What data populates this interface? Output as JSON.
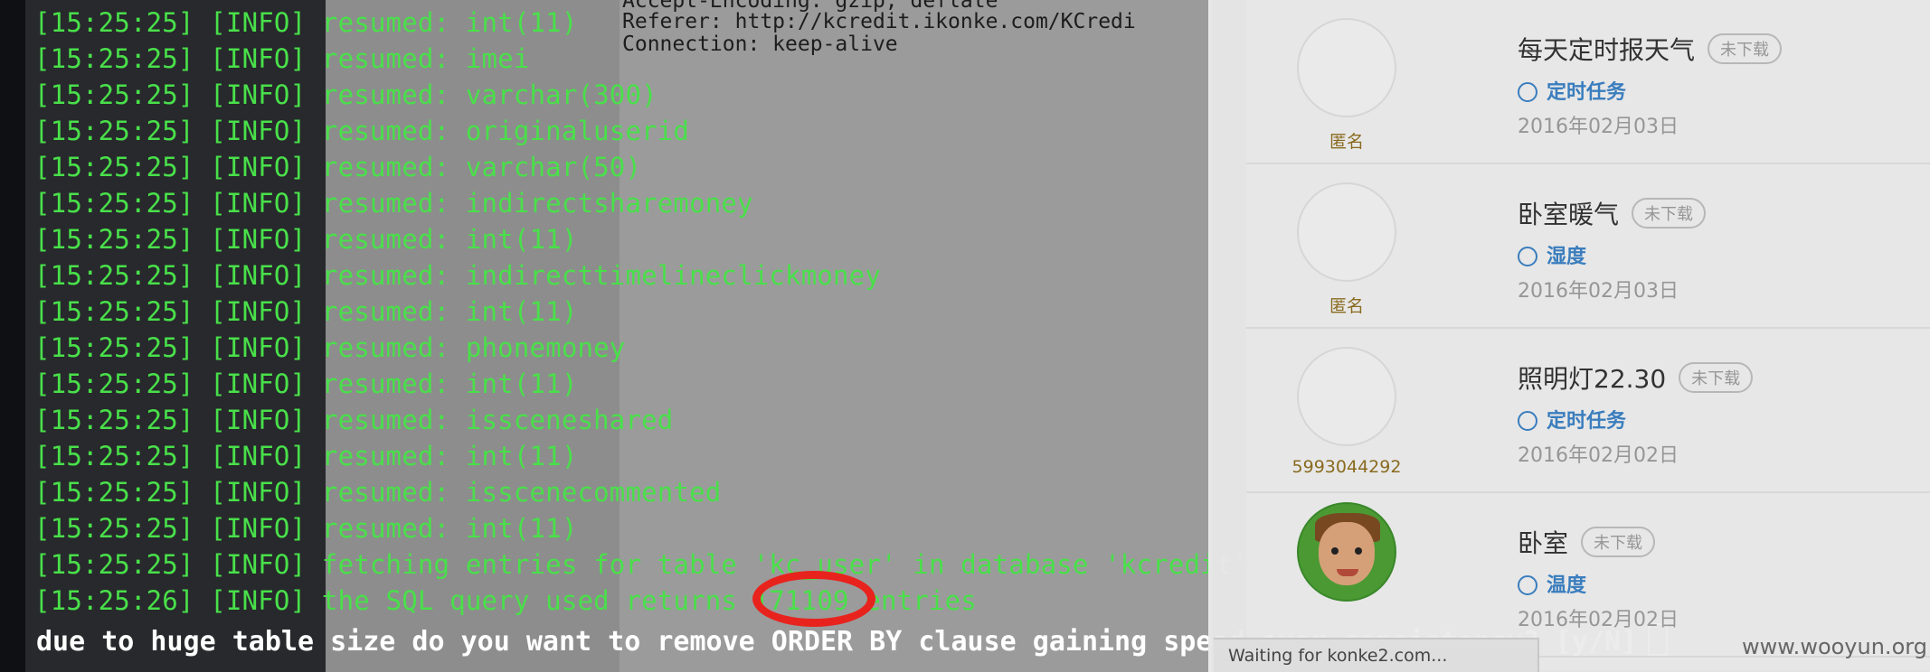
{
  "http_headers": [
    "Accept-Encoding: gzip, deflate",
    "Referer: http://kcredit.ikonke.com/KCredi",
    "Connection: keep-alive"
  ],
  "log_lines": [
    {
      "ts": "[15:25:25]",
      "level": "[INFO]",
      "msg": "resumed: int(11)"
    },
    {
      "ts": "[15:25:25]",
      "level": "[INFO]",
      "msg": "resumed: imei"
    },
    {
      "ts": "[15:25:25]",
      "level": "[INFO]",
      "msg": "resumed: varchar(300)"
    },
    {
      "ts": "[15:25:25]",
      "level": "[INFO]",
      "msg": "resumed: originaluserid"
    },
    {
      "ts": "[15:25:25]",
      "level": "[INFO]",
      "msg": "resumed: varchar(50)"
    },
    {
      "ts": "[15:25:25]",
      "level": "[INFO]",
      "msg": "resumed: indirectsharemoney"
    },
    {
      "ts": "[15:25:25]",
      "level": "[INFO]",
      "msg": "resumed: int(11)"
    },
    {
      "ts": "[15:25:25]",
      "level": "[INFO]",
      "msg": "resumed: indirecttimelineclickmoney"
    },
    {
      "ts": "[15:25:25]",
      "level": "[INFO]",
      "msg": "resumed: int(11)"
    },
    {
      "ts": "[15:25:25]",
      "level": "[INFO]",
      "msg": "resumed: phonemoney"
    },
    {
      "ts": "[15:25:25]",
      "level": "[INFO]",
      "msg": "resumed: int(11)"
    },
    {
      "ts": "[15:25:25]",
      "level": "[INFO]",
      "msg": "resumed: issceneshared"
    },
    {
      "ts": "[15:25:25]",
      "level": "[INFO]",
      "msg": "resumed: int(11)"
    },
    {
      "ts": "[15:25:25]",
      "level": "[INFO]",
      "msg": "resumed: isscenecommented"
    },
    {
      "ts": "[15:25:25]",
      "level": "[INFO]",
      "msg": "resumed: int(11)"
    },
    {
      "ts": "[15:25:25]",
      "level": "[INFO]",
      "msg": "fetching entries for table 'kc_user' in database 'kcredit'"
    },
    {
      "ts": "[15:25:26]",
      "level": "[INFO]",
      "msg": "the SQL query used returns 171109 entries"
    }
  ],
  "prompt": "due to huge table size do you want to remove ORDER BY clause gaining speed over consistency? [y/N]",
  "cards": [
    {
      "avatar_label": "匿名",
      "title": "每天定时报天气",
      "badge": "未下载",
      "tag": "定时任务",
      "tag_icon": "alarm-clock-icon",
      "date": "2016年02月03日"
    },
    {
      "avatar_label": "匿名",
      "title": "卧室暖气",
      "badge": "未下载",
      "tag": "湿度",
      "tag_icon": "sun-icon",
      "date": "2016年02月03日"
    },
    {
      "avatar_label": "5993044292",
      "title": "照明灯22.30",
      "badge": "未下载",
      "tag": "定时任务",
      "tag_icon": "alarm-clock-icon",
      "date": "2016年02月02日"
    },
    {
      "avatar_label": "",
      "title": "卧室",
      "badge": "未下载",
      "tag": "温度",
      "tag_icon": "thermometer-icon",
      "date": "2016年02月02日"
    }
  ],
  "status_bar": "Waiting for konke2.com...",
  "watermark": "www.wooyun.org",
  "colors": {
    "terminal_green": "#49e04a",
    "highlight_red": "#e8231e",
    "tag_blue": "#3b7fc1"
  }
}
